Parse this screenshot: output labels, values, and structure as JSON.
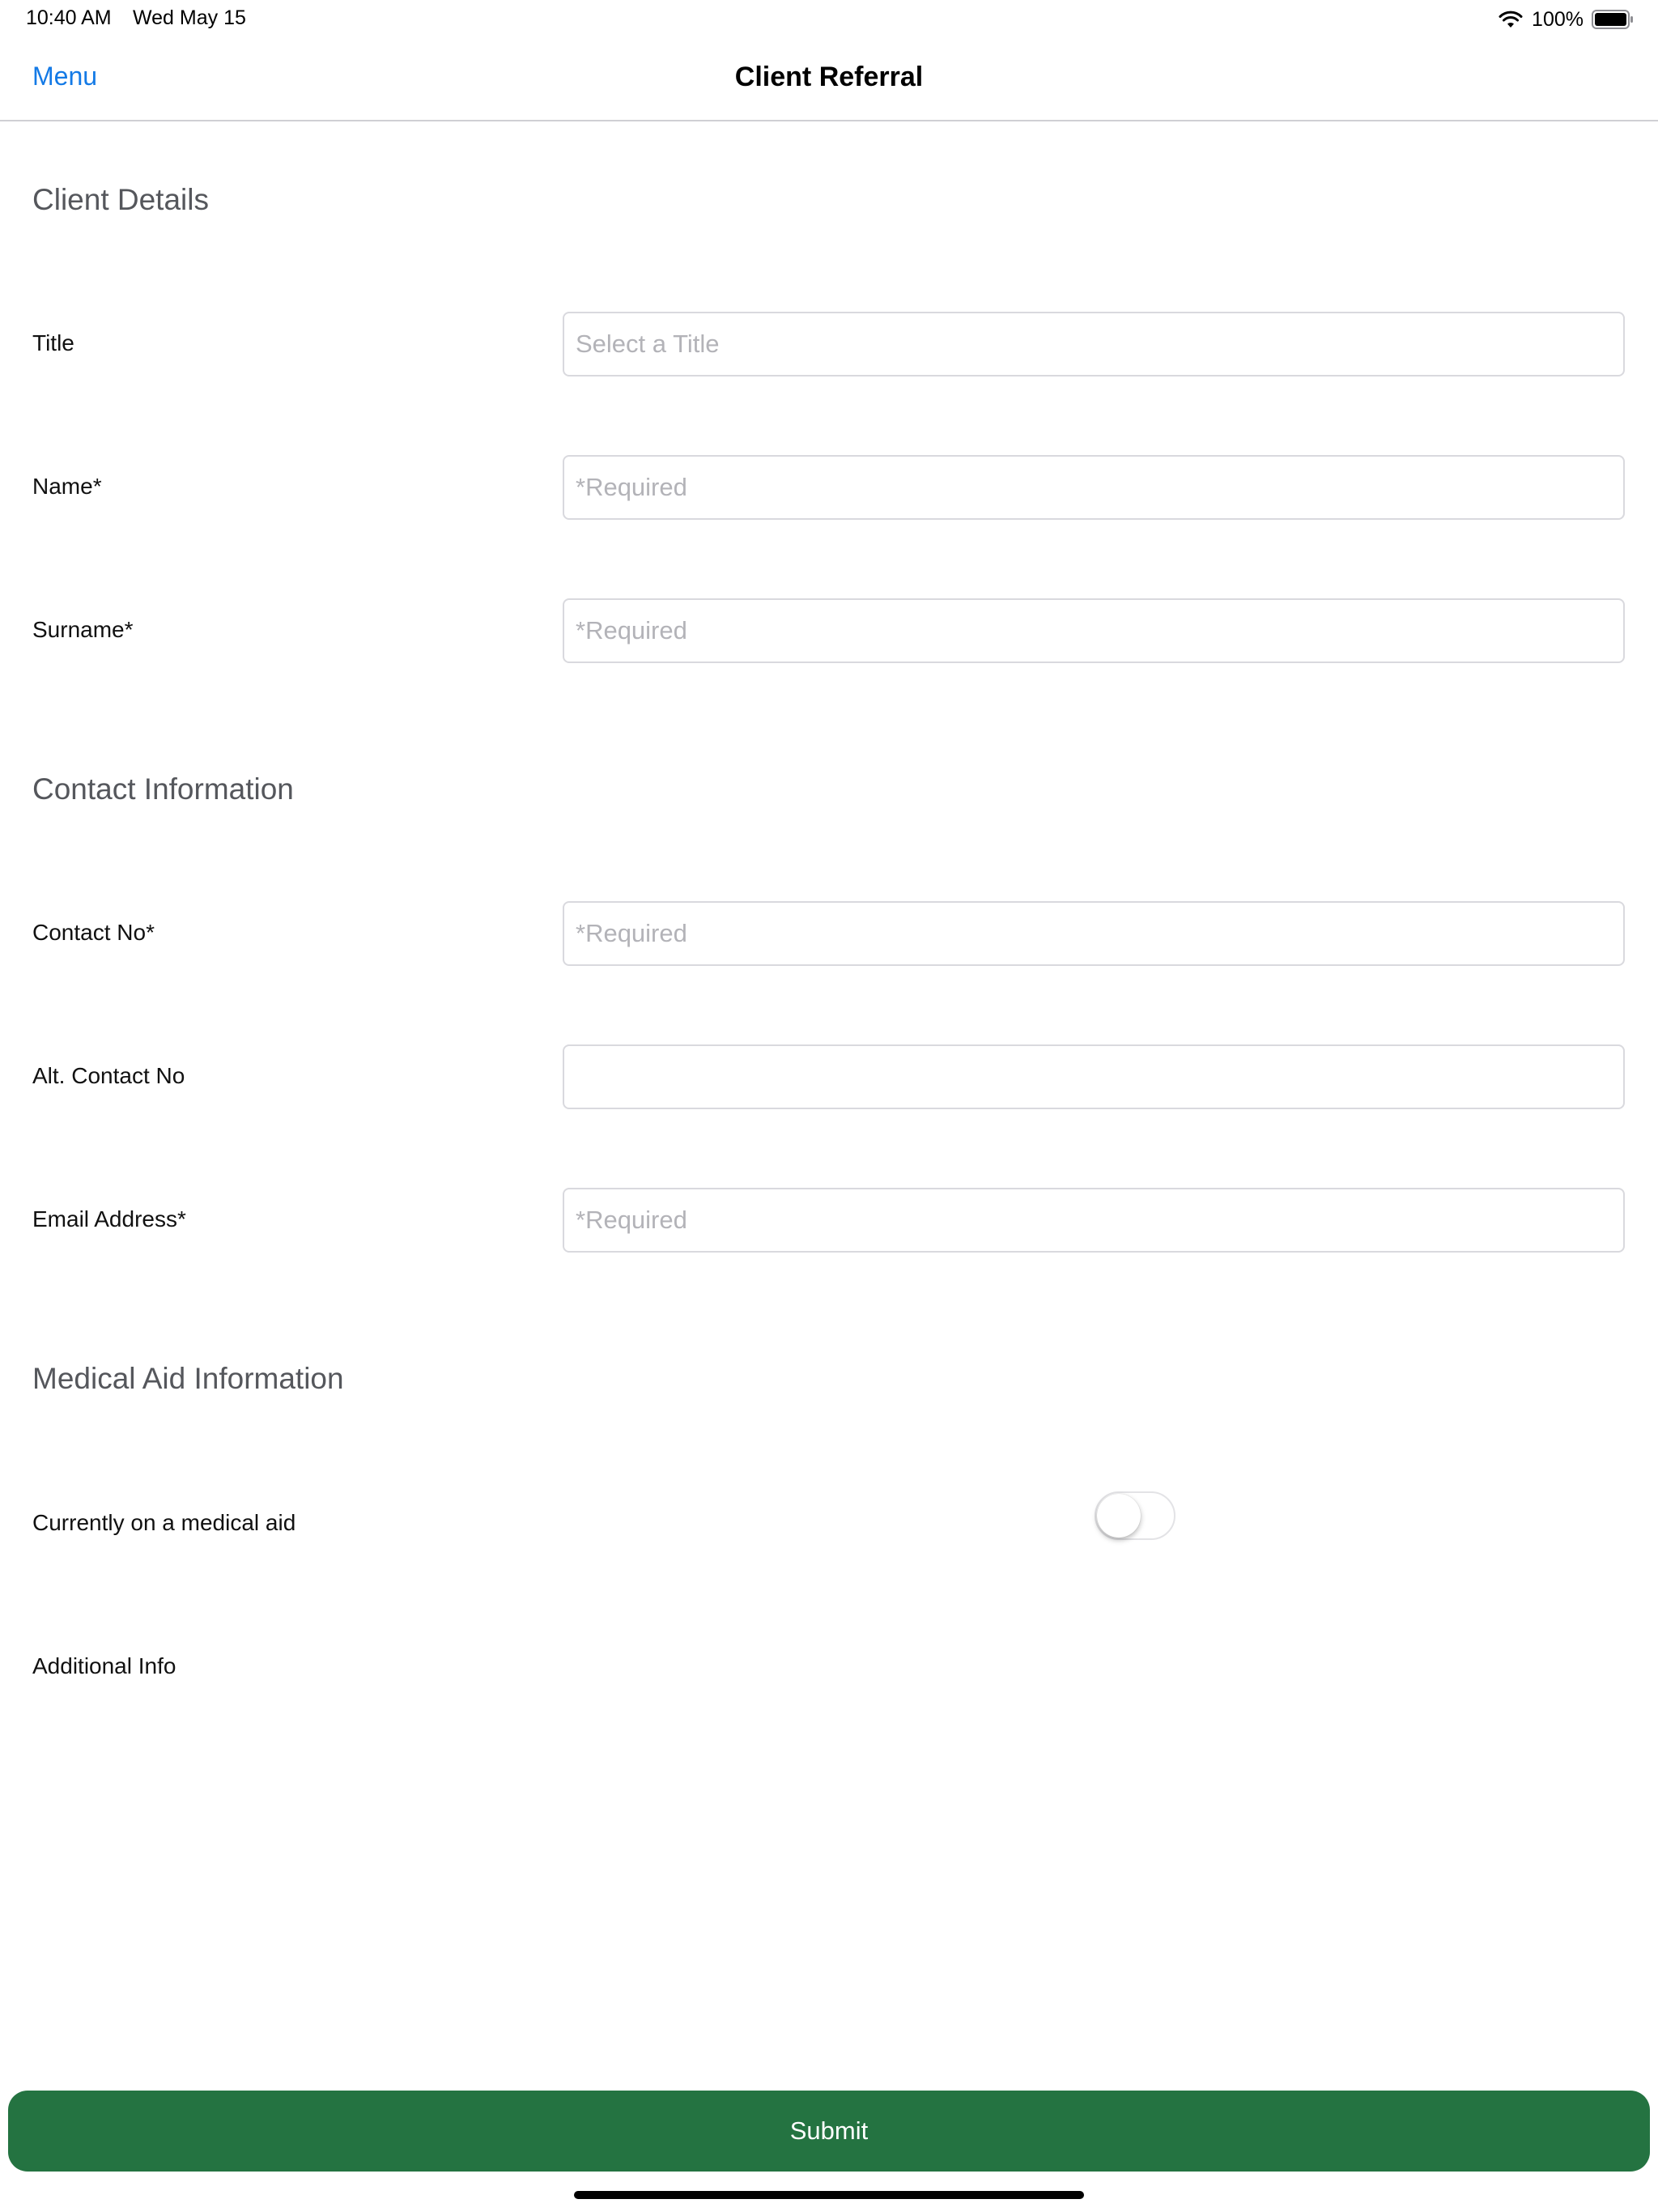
{
  "status_bar": {
    "time": "10:40 AM",
    "date": "Wed May 15",
    "battery": "100%"
  },
  "nav": {
    "menu_label": "Menu",
    "title": "Client Referral"
  },
  "sections": {
    "client_details": "Client Details",
    "contact_information": "Contact Information",
    "medical_aid_information": "Medical Aid Information"
  },
  "fields": {
    "title": {
      "label": "Title",
      "placeholder": "Select a Title",
      "value": ""
    },
    "name": {
      "label": "Name*",
      "placeholder": "*Required",
      "value": ""
    },
    "surname": {
      "label": "Surname*",
      "placeholder": "*Required",
      "value": ""
    },
    "contact_no": {
      "label": "Contact No*",
      "placeholder": "*Required",
      "value": ""
    },
    "alt_contact_no": {
      "label": "Alt. Contact No",
      "placeholder": "",
      "value": ""
    },
    "email": {
      "label": "Email Address*",
      "placeholder": "*Required",
      "value": ""
    }
  },
  "medical_aid": {
    "label": "Currently on a medical aid",
    "enabled": false
  },
  "additional_info": {
    "label": "Additional Info"
  },
  "submit_label": "Submit",
  "colors": {
    "accent_link": "#147ae6",
    "submit_bg": "#247341"
  }
}
